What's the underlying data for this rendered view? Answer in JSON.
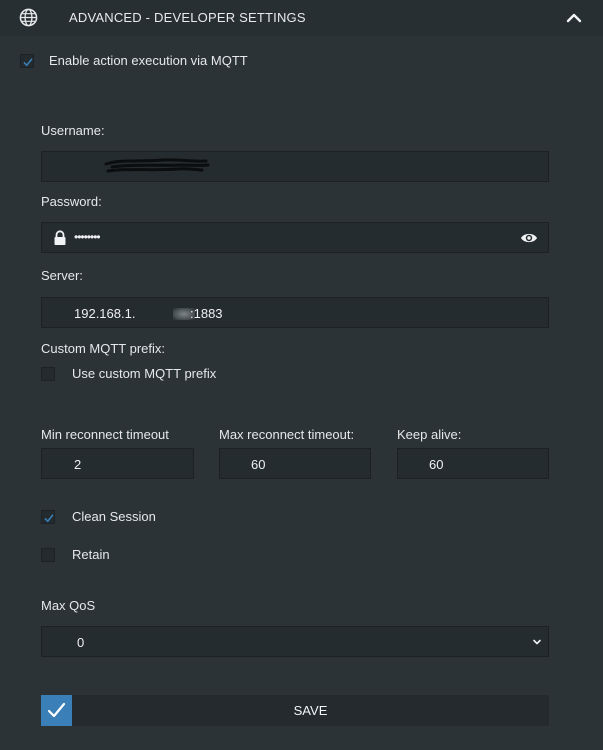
{
  "header": {
    "title": "ADVANCED - DEVELOPER SETTINGS",
    "globe_icon": "globe-icon",
    "collapse_icon": "chevron-up-icon"
  },
  "mqtt_enable": {
    "label": "Enable action execution via MQTT",
    "checked": true
  },
  "username": {
    "label": "Username:",
    "value": ""
  },
  "password": {
    "label": "Password:",
    "value": "••••••••"
  },
  "server": {
    "label": "Server:",
    "value": "192.168.1.",
    "value_tail": ":1883"
  },
  "custom_prefix": {
    "heading": "Custom MQTT prefix:",
    "checkbox_label": "Use custom MQTT prefix",
    "checked": false
  },
  "timeouts": {
    "min_label": "Min reconnect timeout",
    "min_value": "2",
    "max_label": "Max reconnect timeout:",
    "max_value": "60",
    "keepalive_label": "Keep alive:",
    "keepalive_value": "60"
  },
  "clean_session": {
    "label": "Clean Session",
    "checked": true
  },
  "retain": {
    "label": "Retain",
    "checked": false
  },
  "qos": {
    "label": "Max QoS",
    "value": "0"
  },
  "save": {
    "label": "SAVE"
  },
  "colors": {
    "accent": "#3a7fb7",
    "background": "#2b3336",
    "field": "#252c2f"
  }
}
